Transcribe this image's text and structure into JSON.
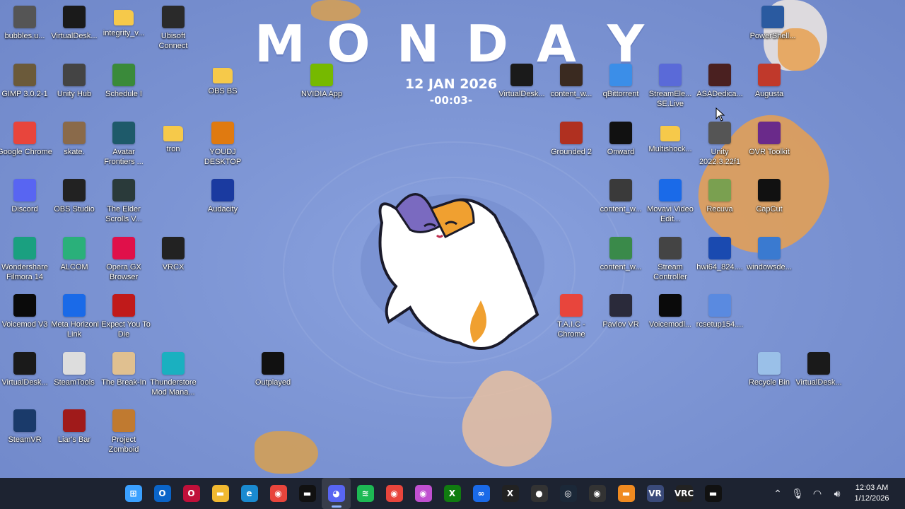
{
  "wallpaper": {
    "day_letters": [
      "M",
      "O",
      "N",
      "D",
      "A",
      "Y"
    ],
    "date": "12 JAN 2026",
    "time": "-00:03-"
  },
  "desktop_icons": [
    {
      "label": "bubbles.u...",
      "icon": "unity-cube-icon",
      "color": "#555"
    },
    {
      "label": "VirtualDesk...",
      "icon": "virtual-desktop-icon",
      "color": "#1a1a1a"
    },
    {
      "label": "integrity_v...",
      "icon": "folder-icon",
      "color": "#f6c94a"
    },
    {
      "label": "Ubisoft Connect",
      "icon": "ubisoft-icon",
      "color": "#2a2a2a"
    },
    {
      "label": "GIMP 3.0.2-1",
      "icon": "gimp-icon",
      "color": "#6b5a3a"
    },
    {
      "label": "Unity Hub",
      "icon": "unity-cube-icon",
      "color": "#444"
    },
    {
      "label": "Schedule I",
      "icon": "schedule-icon",
      "color": "#3a8a3a"
    },
    {
      "label": "OBS BS",
      "icon": "folder-icon",
      "color": "#f6c94a"
    },
    {
      "label": "NVIDIA App",
      "icon": "nvidia-icon",
      "color": "#76b900"
    },
    {
      "label": "VirtualDesk...",
      "icon": "virtual-desktop-icon",
      "color": "#1a1a1a"
    },
    {
      "label": "content_w...",
      "icon": "content-icon",
      "color": "#3a2a20"
    },
    {
      "label": "qBittorrent",
      "icon": "qbittorrent-icon",
      "color": "#3b8ee8"
    },
    {
      "label": "StreamEle... SE.Live",
      "icon": "streamelements-icon",
      "color": "#5a6ad8"
    },
    {
      "label": "ASADedica...",
      "icon": "asa-icon",
      "color": "#4a2020"
    },
    {
      "label": "Augusta",
      "icon": "augusta-icon",
      "color": "#c0392b"
    },
    {
      "label": "PowerShell...",
      "icon": "powershell-icon",
      "color": "#2a5aa0"
    },
    {
      "label": "Google Chrome",
      "icon": "chrome-icon",
      "color": "#e8453c"
    },
    {
      "label": "skate.",
      "icon": "skate-icon",
      "color": "#8a6a4a"
    },
    {
      "label": "Avatar Frontiers ...",
      "icon": "avatar-icon",
      "color": "#1e5a6a"
    },
    {
      "label": "tron",
      "icon": "folder-icon",
      "color": "#f6c94a"
    },
    {
      "label": "YOUDJ DESKTOP",
      "icon": "youdj-icon",
      "color": "#e07a10"
    },
    {
      "label": "Grounded 2",
      "icon": "grounded-icon",
      "color": "#b03020"
    },
    {
      "label": "Onward",
      "icon": "onward-icon",
      "color": "#111"
    },
    {
      "label": "Multishock...",
      "icon": "folder-icon",
      "color": "#f6c94a"
    },
    {
      "label": "Unity 2022.3.22f1",
      "icon": "unity-cube-icon",
      "color": "#555"
    },
    {
      "label": "OVR Toolkit",
      "icon": "ovr-toolkit-icon",
      "color": "#6a2a8a"
    },
    {
      "label": "Discord",
      "icon": "discord-icon",
      "color": "#5865f2"
    },
    {
      "label": "OBS Studio",
      "icon": "obs-icon",
      "color": "#222"
    },
    {
      "label": "The Elder Scrolls V...",
      "icon": "elder-scrolls-icon",
      "color": "#2a3a3a"
    },
    {
      "label": "Audacity",
      "icon": "audacity-icon",
      "color": "#1a3aa0"
    },
    {
      "label": "content_w...",
      "icon": "content-icon",
      "color": "#3a3a3a"
    },
    {
      "label": "Movavi Video Edit...",
      "icon": "movavi-icon",
      "color": "#1a6ae8"
    },
    {
      "label": "Recuva",
      "icon": "recuva-icon",
      "color": "#7aa050"
    },
    {
      "label": "CapCut",
      "icon": "capcut-icon",
      "color": "#111"
    },
    {
      "label": "Wondershare Filmora 14",
      "icon": "filmora-icon",
      "color": "#1aa080"
    },
    {
      "label": "ALCOM",
      "icon": "alcom-icon",
      "color": "#2ab07a"
    },
    {
      "label": "Opera GX Browser",
      "icon": "opera-gx-icon",
      "color": "#e0104a"
    },
    {
      "label": "VRCX",
      "icon": "vrcx-icon",
      "color": "#222"
    },
    {
      "label": "content_w...",
      "icon": "content-icon",
      "color": "#3a8a4a"
    },
    {
      "label": "Stream Controller",
      "icon": "stream-controller-icon",
      "color": "#444"
    },
    {
      "label": "hwi64_824....",
      "icon": "hwinfo-icon",
      "color": "#1a4ab0"
    },
    {
      "label": "windowsde...",
      "icon": "windows-dev-icon",
      "color": "#3a7ad0"
    },
    {
      "label": "Voicemod V3",
      "icon": "voicemod-icon",
      "color": "#0a0a0a"
    },
    {
      "label": "Meta Horizon Link",
      "icon": "meta-icon",
      "color": "#1a6ae8"
    },
    {
      "label": "I Expect You To Die",
      "icon": "iexpectyoutodie-icon",
      "color": "#c01a1a"
    },
    {
      "label": "T.A.I.C - Chrome",
      "icon": "chrome-icon",
      "color": "#e8453c"
    },
    {
      "label": "Pavlov VR",
      "icon": "pavlov-icon",
      "color": "#2a2a3a"
    },
    {
      "label": "Voicemodl...",
      "icon": "voicemod-icon",
      "color": "#0a0a0a"
    },
    {
      "label": "rcsetup154....",
      "icon": "setup-icon",
      "color": "#5a8ae0"
    },
    {
      "label": "VirtualDesk...",
      "icon": "virtual-desktop-icon",
      "color": "#1a1a1a"
    },
    {
      "label": "SteamTools",
      "icon": "steamtools-icon",
      "color": "#ddd"
    },
    {
      "label": "The Break-In",
      "icon": "break-in-icon",
      "color": "#e0c090"
    },
    {
      "label": "Thunderstore Mod Mana...",
      "icon": "thunderstore-icon",
      "color": "#1ab0c0"
    },
    {
      "label": "Outplayed",
      "icon": "outplayed-icon",
      "color": "#111"
    },
    {
      "label": "Recycle Bin",
      "icon": "recycle-bin-icon",
      "color": "#9ac0e8"
    },
    {
      "label": "VirtualDesk...",
      "icon": "virtual-desktop-icon",
      "color": "#1a1a1a"
    },
    {
      "label": "SteamVR",
      "icon": "steamvr-icon",
      "color": "#1a3a6a"
    },
    {
      "label": "Liar's Bar",
      "icon": "liars-bar-icon",
      "color": "#a01a1a"
    },
    {
      "label": "Project Zomboid",
      "icon": "project-zomboid-icon",
      "color": "#c07a30"
    }
  ],
  "taskbar": {
    "apps": [
      {
        "name": "start-button",
        "glyph": "⊞",
        "color": "#3aa0ff",
        "active": false
      },
      {
        "name": "outlook-icon",
        "glyph": "O",
        "color": "#0a64c8",
        "active": false
      },
      {
        "name": "opera-gx-icon",
        "glyph": "O",
        "color": "#c0103a",
        "active": false
      },
      {
        "name": "file-explorer-icon",
        "glyph": "▬",
        "color": "#f0b830",
        "active": false
      },
      {
        "name": "edge-icon",
        "glyph": "e",
        "color": "#1a8ad0",
        "active": false
      },
      {
        "name": "chrome-icon",
        "glyph": "◉",
        "color": "#e8453c",
        "active": false
      },
      {
        "name": "nvidia-icon",
        "glyph": "▬",
        "color": "#111",
        "active": false
      },
      {
        "name": "discord-icon",
        "glyph": "◕",
        "color": "#5865f2",
        "active": true
      },
      {
        "name": "spotify-icon",
        "glyph": "≋",
        "color": "#1db954",
        "active": false
      },
      {
        "name": "chrome-profile-icon",
        "glyph": "◉",
        "color": "#e8453c",
        "active": false
      },
      {
        "name": "chrome-profile-2-icon",
        "glyph": "◉",
        "color": "#c050d0",
        "active": false
      },
      {
        "name": "xbox-icon",
        "glyph": "X",
        "color": "#107c10",
        "active": false
      },
      {
        "name": "meta-icon",
        "glyph": "∞",
        "color": "#1a6ae8",
        "active": false
      },
      {
        "name": "vrcx-icon",
        "glyph": "X",
        "color": "#222",
        "active": false
      },
      {
        "name": "obs-icon",
        "glyph": "●",
        "color": "#333",
        "active": false
      },
      {
        "name": "steam-icon",
        "glyph": "◎",
        "color": "#1b2838",
        "active": false
      },
      {
        "name": "obs-recording-icon",
        "glyph": "◉",
        "color": "#333",
        "active": false
      },
      {
        "name": "folder-icon",
        "glyph": "▬",
        "color": "#f08a20",
        "active": false
      },
      {
        "name": "steamvr-icon",
        "glyph": "VR",
        "color": "#3a4a7a",
        "active": false
      },
      {
        "name": "vrchat-icon",
        "glyph": "VRC",
        "color": "#222",
        "active": false
      },
      {
        "name": "nvidia-2-icon",
        "glyph": "▬",
        "color": "#111",
        "active": false
      }
    ],
    "clock_time": "12:03 AM",
    "clock_date": "1/12/2026"
  }
}
